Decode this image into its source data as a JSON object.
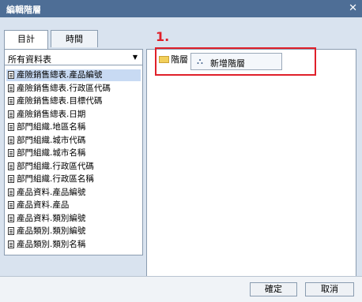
{
  "dialog": {
    "title": "編輯階層"
  },
  "tabs": [
    {
      "label": "目計"
    },
    {
      "label": "時間"
    }
  ],
  "dropdown": {
    "selected": "所有資料表"
  },
  "fields": [
    "產險銷售總表.產品編號",
    "產險銷售總表.行政區代碼",
    "產險銷售總表.目標代碼",
    "產險銷售總表.日期",
    "部門組織.地區名稱",
    "部門組織.城市代碼",
    "部門組織.城市名稱",
    "部門組織.行政區代碼",
    "部門組織.行政區名稱",
    "產品資料.產品編號",
    "產品資料.產品",
    "產品資料.類別編號",
    "產品類別.類別編號",
    "產品類別.類別名稱"
  ],
  "hierarchy": {
    "node_label": "階層",
    "menu_item": "新增階層"
  },
  "annotation": {
    "label": "1."
  },
  "footer": {
    "ok_label": "確定",
    "cancel_label": "取消"
  },
  "colors": {
    "titlebar": "#4e6e96",
    "annotation": "#e0202a",
    "selected_row": "#c8daf3"
  }
}
